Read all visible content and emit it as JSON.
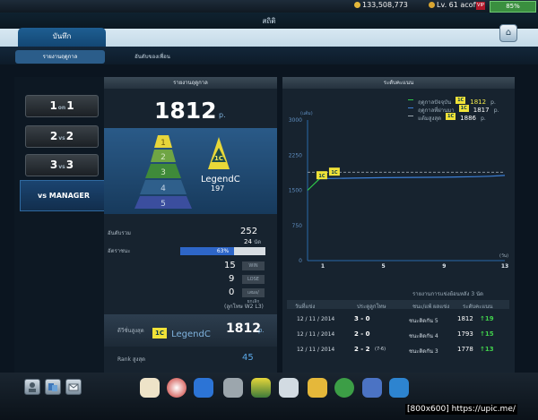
{
  "topbar": {
    "coins": "133,508,773",
    "level": "Lv. 61 acoffo",
    "vip": "VIP",
    "progress": "85%"
  },
  "header": {
    "title": "สถิติ"
  },
  "tabs": {
    "main": "บันทึก",
    "sub": [
      "รายงานฤดูกาล",
      "อันดับของเพื่อน"
    ]
  },
  "modes": [
    {
      "num1": "1",
      "sep": "on",
      "num2": "1"
    },
    {
      "num1": "2",
      "sep": "vs",
      "num2": "2"
    },
    {
      "num1": "3",
      "sep": "vs",
      "num2": "3"
    },
    {
      "label": "vs MANAGER"
    }
  ],
  "season": {
    "header": "รายงานฤดูกาล",
    "score": "1812",
    "score_unit": "p.",
    "pyramid_levels": [
      "1",
      "2",
      "3",
      "4",
      "5"
    ],
    "tier_name": "LegendC",
    "tier_badge": "1C",
    "tier_rank": "197",
    "rank_label": "อันดับรวม",
    "rank_value": "252",
    "games": "24",
    "games_unit": "นัด",
    "winrate_label": "อัตราชนะ",
    "winrate_pct": "63%",
    "winrate_fraction": 0.63,
    "wins": "15",
    "win_label": "WIN",
    "losses": "9",
    "lose_label": "LOSE",
    "draws": "0",
    "draw_label": "เสมอ/ยกเลิก",
    "note": "(ลูกโทษ W2 L3)",
    "best_label": "ดีวีชั่นสูงสุด",
    "best_tier": "LegendC",
    "best_score": "1812",
    "best_unit": "p.",
    "best_rank_label": "Rank สูงสุด",
    "best_rank": "45"
  },
  "rating": {
    "header": "ระดับคะแนน",
    "legend": [
      {
        "label": "ฤดูกาลปัจจุบัน",
        "badge": "1C",
        "value": "1812",
        "unit": "p."
      },
      {
        "label": "ฤดูกาลที่ผ่านมา",
        "badge": "1C",
        "value": "1817",
        "unit": "p."
      },
      {
        "label": "แต้มสูงสุด",
        "badge": "1C",
        "value": "1886",
        "unit": "p."
      }
    ],
    "unit_y": "(แต้ม)",
    "unit_x": "(วัน)",
    "colors": {
      "current": "#2fc94a",
      "previous": "#3c7fd6",
      "high": "#9aa5ae"
    }
  },
  "chart_data": {
    "type": "line",
    "ylabel": "(แต้ม)",
    "xlabel": "(วัน)",
    "ylim": [
      0,
      3000
    ],
    "xlim": [
      0,
      13
    ],
    "yticks": [
      "3000",
      "2250",
      "1500",
      "750",
      "0"
    ],
    "xticks": [
      "1",
      "5",
      "9",
      "13"
    ],
    "series": [
      {
        "name": "ฤดูกาลปัจจุบัน",
        "type": "line",
        "x": [
          0,
          1
        ],
        "y": [
          1500,
          1812
        ]
      },
      {
        "name": "ฤดูกาลที่ผ่านมา",
        "type": "line",
        "x": [
          1,
          3,
          5,
          7,
          9,
          11,
          12,
          13
        ],
        "y": [
          1750,
          1760,
          1770,
          1775,
          1780,
          1790,
          1800,
          1817
        ]
      },
      {
        "name": "แต้มสูงสุด",
        "type": "dashed",
        "x": [
          0,
          13
        ],
        "y": [
          1886,
          1886
        ]
      }
    ],
    "marker": {
      "x": 1,
      "y": 1812,
      "badge": "1C"
    }
  },
  "history": {
    "caption": "รายงานการแข่งย้อนหลัง 3 นัด",
    "columns": [
      "วันที่แข่ง",
      "ประตูลูกโทษ",
      "ชนะ/แพ้ ผลแข่ง",
      "ระดับคะแนน"
    ],
    "rows": [
      {
        "date": "12 / 11 / 2014",
        "score": "3 - 0",
        "extra": "",
        "result": "ชนะติดกัน 5",
        "points": "1812",
        "delta": "19"
      },
      {
        "date": "12 / 11 / 2014",
        "score": "2 - 0",
        "extra": "",
        "result": "ชนะติดกัน 4",
        "points": "1793",
        "delta": "15"
      },
      {
        "date": "12 / 11 / 2014",
        "score": "2 - 2",
        "extra": "(7-6)",
        "result": "ชนะติดกัน 3",
        "points": "1778",
        "delta": "13"
      }
    ]
  },
  "watermark": "[800x600] https://upic.me/"
}
